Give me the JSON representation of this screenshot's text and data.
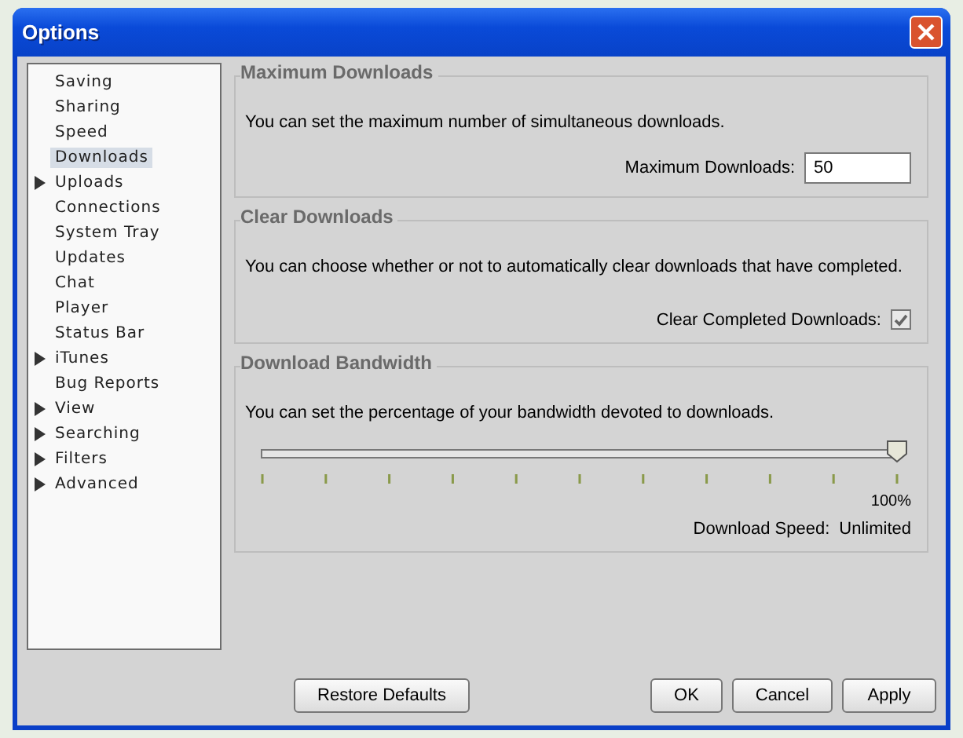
{
  "window": {
    "title": "Options"
  },
  "sidebar": {
    "items": [
      {
        "label": "Saving",
        "kind": "leaf",
        "selected": false
      },
      {
        "label": "Sharing",
        "kind": "leaf",
        "selected": false
      },
      {
        "label": "Speed",
        "kind": "leaf",
        "selected": false
      },
      {
        "label": "Downloads",
        "kind": "leaf",
        "selected": true
      },
      {
        "label": "Uploads",
        "kind": "branch",
        "selected": false
      },
      {
        "label": "Connections",
        "kind": "leaf",
        "selected": false
      },
      {
        "label": "System Tray",
        "kind": "leaf",
        "selected": false
      },
      {
        "label": "Updates",
        "kind": "leaf",
        "selected": false
      },
      {
        "label": "Chat",
        "kind": "leaf",
        "selected": false
      },
      {
        "label": "Player",
        "kind": "leaf",
        "selected": false
      },
      {
        "label": "Status Bar",
        "kind": "leaf",
        "selected": false
      },
      {
        "label": "iTunes",
        "kind": "branch",
        "selected": false
      },
      {
        "label": "Bug Reports",
        "kind": "leaf",
        "selected": false
      },
      {
        "label": "View",
        "kind": "branch",
        "selected": false
      },
      {
        "label": "Searching",
        "kind": "branch",
        "selected": false
      },
      {
        "label": "Filters",
        "kind": "branch",
        "selected": false
      },
      {
        "label": "Advanced",
        "kind": "branch",
        "selected": false
      }
    ]
  },
  "sections": [
    {
      "title": "Maximum Downloads",
      "description": "You can set the maximum number of simultaneous downloads.",
      "kind": "field",
      "label": "Maximum Downloads:",
      "value": "50"
    },
    {
      "title": "Clear Downloads",
      "description": "You can choose whether or not to automatically clear downloads that have completed.",
      "kind": "checkbox",
      "label": "Clear Completed Downloads:",
      "checked": true
    },
    {
      "title": "Download Bandwidth",
      "description": "You can set the percentage of your bandwidth devoted to downloads.",
      "kind": "slider",
      "level": 1.0,
      "reading": "100%",
      "speed_label": "Download Speed:",
      "speed_value": "Unlimited"
    }
  ],
  "buttons": {
    "restore": "Restore Defaults",
    "actions": [
      "OK",
      "Cancel",
      "Apply"
    ]
  }
}
